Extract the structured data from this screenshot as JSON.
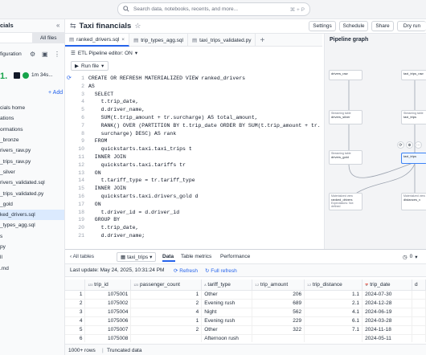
{
  "search": {
    "placeholder": "Search data, notebooks, recents, and more...",
    "shortcut": "⌘ + P"
  },
  "sidebar": {
    "title": "cials",
    "tabs": [
      "",
      "All files"
    ],
    "config_label": "figuration",
    "status_code": "1.",
    "timer": "1m 34s...",
    "add_label": "Add",
    "items": [
      "cials home",
      "ations",
      "ormations",
      "_bronze",
      "rivers_raw.py",
      "_trips_raw.py",
      "_silver",
      "rivers_validated.sql",
      "_trips_validated.py",
      "_gold",
      "ked_drivers.sql",
      "_types_agg.sql",
      "s",
      "py",
      "ll",
      ".md"
    ],
    "active_index": 10
  },
  "header": {
    "title": "Taxi financials",
    "buttons": {
      "settings": "Settings",
      "schedule": "Schedule",
      "share": "Share",
      "dry_run": "Dry run"
    }
  },
  "file_tabs": [
    "ranked_drivers.sql",
    "trip_types_agg.sql",
    "taxi_trips_validated.py"
  ],
  "editor": {
    "pipeline_toggle": "ETL Pipeline editor: ON",
    "run_file": "Run file",
    "lines": [
      "CREATE OR REFRESH MATERIALIZED VIEW ranked_drivers",
      "AS",
      "  SELECT",
      "    t.trip_date,",
      "    d.driver_name,",
      "    SUM(t.trip_amount + tr.surcharge) AS total_amount,",
      "    RANK() OVER (PARTITION BY t.trip_date ORDER BY SUM(t.trip_amount + tr.",
      "    surcharge) DESC) AS rank",
      "  FROM",
      "    quickstarts.taxi.taxi_trips t",
      "  INNER JOIN",
      "    quickstarts.taxi.tariffs tr",
      "  ON",
      "    t.tariff_type = tr.tariff_type",
      "  INNER JOIN",
      "    quickstarts.taxi.drivers_gold d",
      "  ON",
      "    t.driver_id = d.driver_id",
      "  GROUP BY",
      "    t.trip_date,",
      "    d.driver_name;"
    ],
    "line_numbers": [
      "1",
      "2",
      "3",
      "4",
      "5",
      "6",
      "7",
      "8",
      "9",
      "10",
      "11",
      "12",
      "13",
      "14",
      "15",
      "16",
      "17",
      "18",
      "19",
      "20",
      "21"
    ]
  },
  "pipeline_graph": {
    "title": "Pipeline graph",
    "nodes": {
      "drivers_raw": "drivers_raw",
      "drivers_silver": "drivers_silver",
      "drivers_gold": "drivers_gold",
      "taxi_trips": "taxi_trips",
      "taxi_trips_raw": "taxi_trips_raw",
      "taxi_trips_silver": "taxi_trips",
      "ranked_drivers": "ranked_drivers",
      "trip_types": "distances_v",
      "kind_streaming": "Streaming table",
      "kind_materialized": "Materialized view",
      "expectation_ok": "Expectations: 0 / 1 meet",
      "expectation_none": "Expectations: Not defined"
    }
  },
  "bottom": {
    "all_tables": "All tables",
    "table_name": "taxi_trips",
    "tabs": [
      "Data",
      "Table metrics",
      "Performance"
    ],
    "last_update": "Last update: May 24, 2025, 10:31:24 PM",
    "refresh": "Refresh",
    "full_refresh": "Full refresh",
    "counter": "0",
    "columns": [
      "trip_id",
      "passenger_count",
      "tariff_type",
      "trip_amount",
      "trip_distance",
      "trip_date",
      "d"
    ],
    "column_types": [
      "123",
      "123",
      "A",
      "1.2",
      "1.2",
      "📅",
      ""
    ],
    "rows": [
      [
        "1",
        "1075001",
        "1",
        "Other",
        "206",
        "1.1",
        "2024-07-30"
      ],
      [
        "2",
        "1075002",
        "2",
        "Evening rush",
        "689",
        "2.1",
        "2024-12-28"
      ],
      [
        "3",
        "1075004",
        "4",
        "Night",
        "562",
        "4.1",
        "2024-06-19"
      ],
      [
        "4",
        "1075006",
        "1",
        "Evening rush",
        "229",
        "6.1",
        "2024-03-28"
      ],
      [
        "5",
        "1075007",
        "2",
        "Other",
        "322",
        "7.1",
        "2024-11-18"
      ],
      [
        "6",
        "1075008",
        "",
        "Afternoon rush",
        "",
        "",
        "2024-05-11"
      ]
    ],
    "footer_rows": "1000+ rows",
    "footer_truncated": "Truncated data"
  }
}
